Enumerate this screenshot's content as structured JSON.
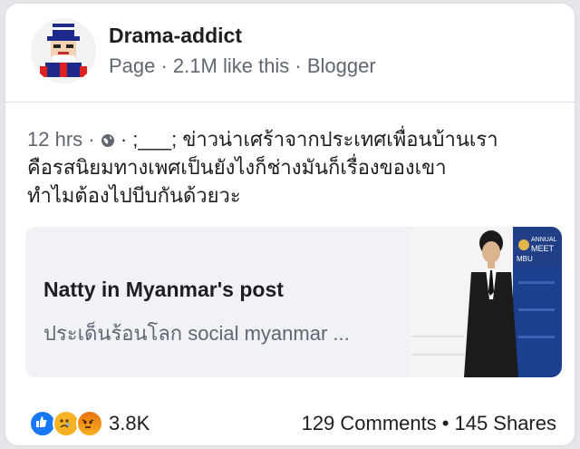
{
  "post": {
    "page_name": "Drama-addict",
    "page_meta": "Page · 2.1M like this · Blogger",
    "time": "12 hrs ·",
    "audience_icon": "globe-icon",
    "text_line1": " · ;___; ข่าวน่าเศร้าจากประเทศเพื่อนบ้านเรา",
    "text_line2": "คือรสนิยมทางเพศเป็นยังไงก็ช่างมันก็เรื่องของเขา",
    "text_line3": "ทำไมต้องไปบีบกันด้วยวะ"
  },
  "link_preview": {
    "title": "Natty in Myanmar's post",
    "subtitle": "ประเด็นร้อนโลก social myanmar ...",
    "banner_text_1": "ANNUAL",
    "banner_text_2": "MEET",
    "banner_text_3": "MBU"
  },
  "engagement": {
    "reaction_icons": [
      "like-icon",
      "sad-icon",
      "angry-icon"
    ],
    "reaction_count": "3.8K",
    "comments": "129 Comments",
    "separator": "•",
    "shares": "145 Shares"
  },
  "colors": {
    "background": "#e4e6ea",
    "card": "#ffffff",
    "link_card": "#f0f2f5",
    "meta_text": "#606770",
    "like_blue": "#1877f2",
    "sad_yellow": "#f7b125"
  }
}
